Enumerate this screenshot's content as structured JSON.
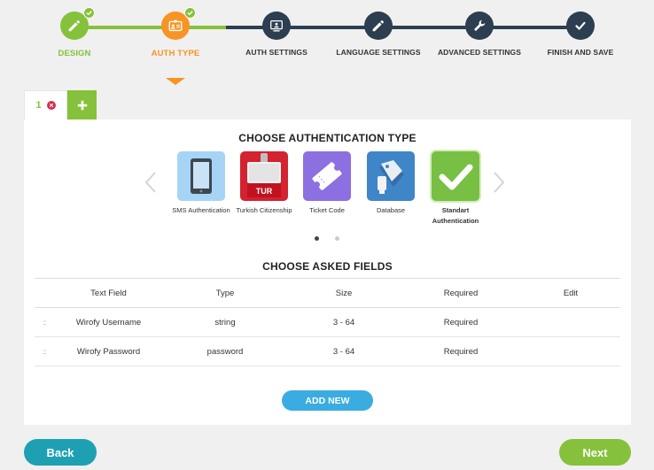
{
  "stepper": {
    "steps": [
      {
        "label": "DESIGN",
        "status": "done",
        "icon": "pencil-icon",
        "color": "#86c13b"
      },
      {
        "label": "AUTH TYPE",
        "status": "current",
        "icon": "id-card-icon",
        "color": "#f79425"
      },
      {
        "label": "AUTH SETTINGS",
        "status": "pending",
        "icon": "monitor-user-icon",
        "color": "#2c3e50"
      },
      {
        "label": "LANGUAGE SETTINGS",
        "status": "pending",
        "icon": "pencil-icon",
        "color": "#2c3e50"
      },
      {
        "label": "ADVANCED SETTINGS",
        "status": "pending",
        "icon": "wrench-icon",
        "color": "#2c3e50"
      },
      {
        "label": "FINISH AND SAVE",
        "status": "pending",
        "icon": "check-icon",
        "color": "#2c3e50"
      }
    ]
  },
  "tabs": {
    "items": [
      {
        "label": "1"
      }
    ],
    "add_icon": "plus-icon"
  },
  "auth": {
    "title": "CHOOSE AUTHENTICATION TYPE",
    "options": [
      {
        "label": "SMS Authentication",
        "icon": "phone-icon",
        "color": "#a6d4f7"
      },
      {
        "label": "Turkish Citizenship",
        "icon": "id-badge-icon",
        "color": "#d32230",
        "badge": "TUR"
      },
      {
        "label": "Ticket Code",
        "icon": "ticket-icon",
        "color": "#8c6fe0"
      },
      {
        "label": "Database",
        "icon": "tag-icon",
        "color": "#3f86c8"
      },
      {
        "label": "Standart Authentication",
        "icon": "check-icon",
        "color": "#77c043",
        "selected": true
      }
    ],
    "carousel_pages": 2,
    "carousel_active_page": 1
  },
  "fields": {
    "title": "CHOOSE ASKED FIELDS",
    "columns": [
      "Text Field",
      "Type",
      "Size",
      "Required",
      "Edit"
    ],
    "rows": [
      {
        "handle": "::",
        "text_field": "Wirofy Username",
        "type": "string",
        "size": "3 - 64",
        "required": "Required",
        "edit": ""
      },
      {
        "handle": "::",
        "text_field": "Wirofy Password",
        "type": "password",
        "size": "3 - 64",
        "required": "Required",
        "edit": ""
      }
    ],
    "add_new_label": "ADD NEW"
  },
  "footer": {
    "back_label": "Back",
    "next_label": "Next"
  },
  "colors": {
    "green": "#86c13b",
    "orange": "#f79425",
    "navy": "#2c3e50",
    "blue": "#3bace2",
    "teal": "#1ea0b3"
  }
}
